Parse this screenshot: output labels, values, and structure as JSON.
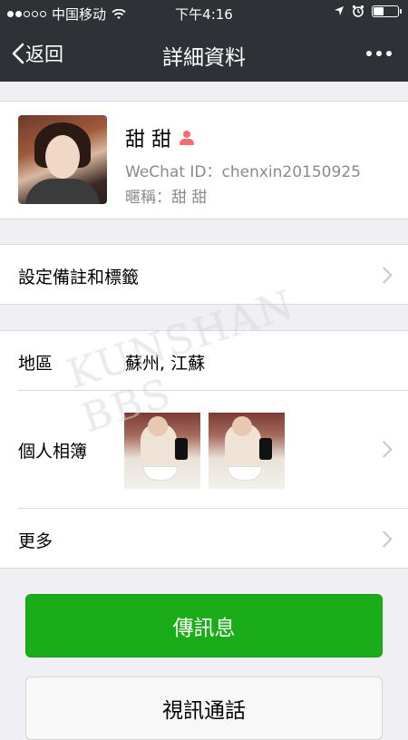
{
  "status_bar": {
    "carrier": "中国移动",
    "time": "下午4:16",
    "signal_bars_filled": 2,
    "signal_bars_total": 5,
    "battery_level": 0.4
  },
  "nav": {
    "back_label": "返回",
    "title": "詳細資料"
  },
  "profile": {
    "name": "甜 甜",
    "wechat_id": "WeChat ID：chenxin20150925",
    "nickname": "暱稱：甜 甜"
  },
  "tag_row": {
    "label": "設定備註和標籤"
  },
  "info": {
    "region_label": "地區",
    "region_value": "蘇州, 江蘇",
    "album_label": "個人相簿",
    "more_label": "更多"
  },
  "buttons": {
    "send_message": "傳訊息",
    "video_call": "視訊通話"
  },
  "watermark": "KUNSHAN BBS",
  "colors": {
    "nav_bg": "#2e3135",
    "primary_green": "#1aad19",
    "gender_icon": "#f26d6d",
    "page_bg": "#efeff4"
  }
}
